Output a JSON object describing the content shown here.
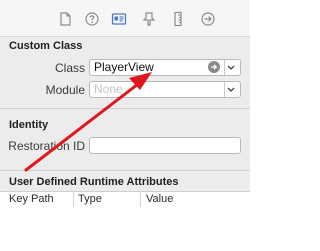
{
  "toolbar": {
    "icons": [
      "file-icon",
      "help-icon",
      "identity-icon",
      "attributes-icon",
      "size-ruler-icon",
      "connections-arrow-icon"
    ],
    "active_icon": "identity-icon",
    "accent_color": "#4a78c4"
  },
  "custom_class": {
    "title": "Custom Class",
    "class_label": "Class",
    "class_value": "PlayerView",
    "module_label": "Module",
    "module_placeholder": "None"
  },
  "identity": {
    "title": "Identity",
    "restoration_id_label": "Restoration ID",
    "restoration_id_value": ""
  },
  "runtime_attributes": {
    "title": "User Defined Runtime Attributes",
    "columns": [
      "Key Path",
      "Type",
      "Value"
    ]
  },
  "annotation": {
    "arrow_color": "#e0171c"
  }
}
